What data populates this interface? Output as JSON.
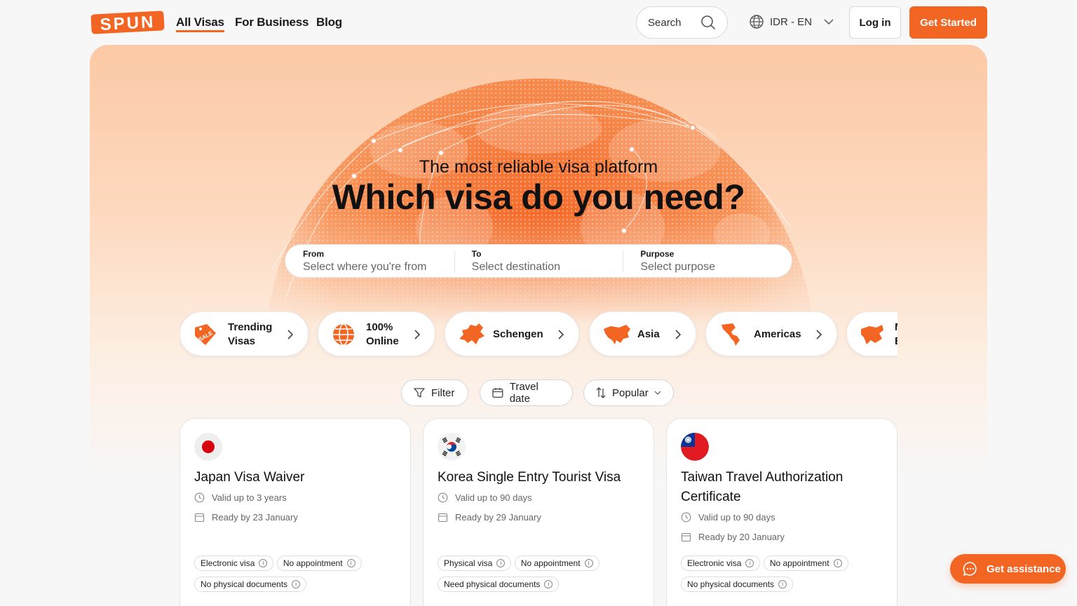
{
  "brand": {
    "logo_text": "SPUN",
    "accent": "#f26522"
  },
  "nav": {
    "items": [
      "All Visas",
      "For Business",
      "Blog"
    ],
    "active": "All Visas"
  },
  "header": {
    "search_label": "Search",
    "currency_lang": "IDR - EN",
    "login": "Log in",
    "get_started": "Get Started"
  },
  "hero": {
    "subtitle": "The most reliable visa platform",
    "title": "Which visa do you need?"
  },
  "search_form": {
    "from_label": "From",
    "from_placeholder": "Select where you're from",
    "to_label": "To",
    "to_placeholder": "Select destination",
    "purpose_label": "Purpose",
    "purpose_placeholder": "Select purpose"
  },
  "categories": [
    {
      "line1": "Trending",
      "line2": "Visas",
      "icon": "sale-tag-icon"
    },
    {
      "line1": "100%",
      "line2": "Online",
      "icon": "globe-icon"
    },
    {
      "line1": "Schengen",
      "line2": "",
      "icon": "europe-map-icon"
    },
    {
      "line1": "Asia",
      "line2": "",
      "icon": "asia-map-icon"
    },
    {
      "line1": "Americas",
      "line2": "",
      "icon": "americas-map-icon"
    },
    {
      "line1": "M",
      "line2": "E",
      "icon": "middle-east-map-icon"
    }
  ],
  "filters": {
    "filter": "Filter",
    "travel_date": "Travel date",
    "sort": "Popular"
  },
  "cards": [
    {
      "flag": "japan-flag-icon",
      "title": "Japan Visa Waiver",
      "valid": "Valid up to 3 years",
      "ready": "Ready by 23 January",
      "tags": [
        "Electronic visa",
        "No appointment",
        "No physical documents"
      ]
    },
    {
      "flag": "korea-flag-icon",
      "title": "Korea Single Entry Tourist Visa",
      "valid": "Valid up to 90 days",
      "ready": "Ready by 29 January",
      "tags": [
        "Physical visa",
        "No appointment",
        "Need physical documents"
      ]
    },
    {
      "flag": "taiwan-flag-icon",
      "title": "Taiwan Travel Authorization Certificate",
      "valid": "Valid up to 90 days",
      "ready": "Ready by 20 January",
      "tags": [
        "Electronic visa",
        "No appointment",
        "No physical documents"
      ]
    }
  ],
  "assistance": {
    "label": "Get assistance"
  }
}
